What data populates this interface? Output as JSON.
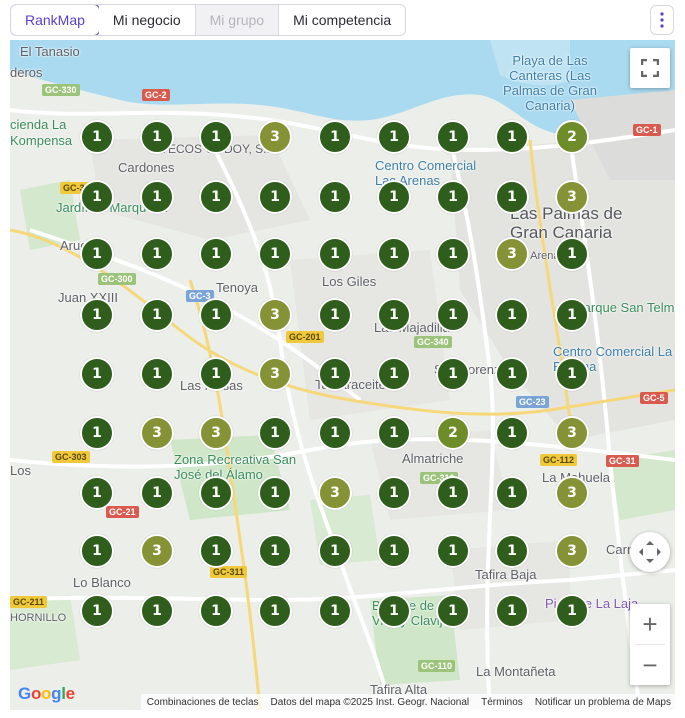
{
  "tabs": [
    {
      "label": "RankMap",
      "state": "active"
    },
    {
      "label": "Mi negocio",
      "state": "normal"
    },
    {
      "label": "Mi grupo",
      "state": "disabled"
    },
    {
      "label": "Mi competencia",
      "state": "normal"
    }
  ],
  "more_icon": "kebab-vertical-icon",
  "colors": {
    "accent": "#5b3fd0",
    "rank_1": "#2f5e1c",
    "rank_2": "#6f8c2a",
    "rank_3": "#869236",
    "water": "#aadaf0",
    "urban": "#e8e9e4",
    "park": "#cfe6c8"
  },
  "map": {
    "place_labels": [
      "El Tanasio",
      "deros",
      "cienda La",
      "Kompensa",
      "Cardones",
      "VECOS GODOY, S.L.",
      "Jardín la Marquesa",
      "Aruca",
      "Juan XXIII",
      "Tenoya",
      "Los Giles",
      "Las Majadillas",
      "San Lorenzo",
      "Las Mesas",
      "Tamaraceite",
      "Almatriche",
      "Zona Recreativa San José del Álamo",
      "La Mahuela",
      "Lo Blanco",
      "Tafira Baja",
      "Bosque de Vico y Clavijo",
      "La Montañeta",
      "Tafira Alta",
      "HORNILLO",
      "Los",
      "Playa de Las Canteras (Las Palmas de Gran Canaria)",
      "Centro Comercial Las Arenas",
      "Las Palmas de Gran Canaria",
      "Parque San Telmo",
      "Centro Comercial La Ballena",
      "Pista de La Laja",
      "Carrasco",
      "Las Arenas"
    ],
    "road_labels": [
      "GC-330",
      "GC-2",
      "GC-1",
      "GC-301",
      "GC-300",
      "GC-3",
      "GC-201",
      "GC-340",
      "GC-23",
      "GC-5",
      "GC-303",
      "GC-112",
      "GC-31",
      "GC-310",
      "GC-21",
      "GC-311",
      "GC-211",
      "GC-110"
    ],
    "rank_grid": [
      [
        1,
        1,
        1,
        3,
        1,
        1,
        1,
        1,
        2
      ],
      [
        1,
        1,
        1,
        1,
        1,
        1,
        1,
        1,
        3
      ],
      [
        1,
        1,
        1,
        1,
        1,
        1,
        1,
        3,
        1
      ],
      [
        1,
        1,
        1,
        3,
        1,
        1,
        1,
        1,
        1
      ],
      [
        1,
        1,
        1,
        3,
        1,
        1,
        1,
        1,
        1
      ],
      [
        1,
        3,
        3,
        1,
        1,
        1,
        2,
        1,
        3
      ],
      [
        1,
        1,
        1,
        1,
        3,
        1,
        1,
        1,
        3
      ],
      [
        1,
        3,
        1,
        1,
        1,
        1,
        1,
        1,
        3
      ],
      [
        1,
        1,
        1,
        1,
        1,
        1,
        1,
        1,
        1
      ]
    ],
    "controls": {
      "fullscreen_icon": "fullscreen-icon",
      "pan_icon": "move-pan-icon",
      "zoom_in": "+",
      "zoom_out": "−"
    },
    "logo": "Google",
    "attribution": [
      "Combinaciones de teclas",
      "Datos del mapa ©2025 Inst. Geogr. Nacional",
      "Términos",
      "Notificar un problema de Maps"
    ]
  }
}
